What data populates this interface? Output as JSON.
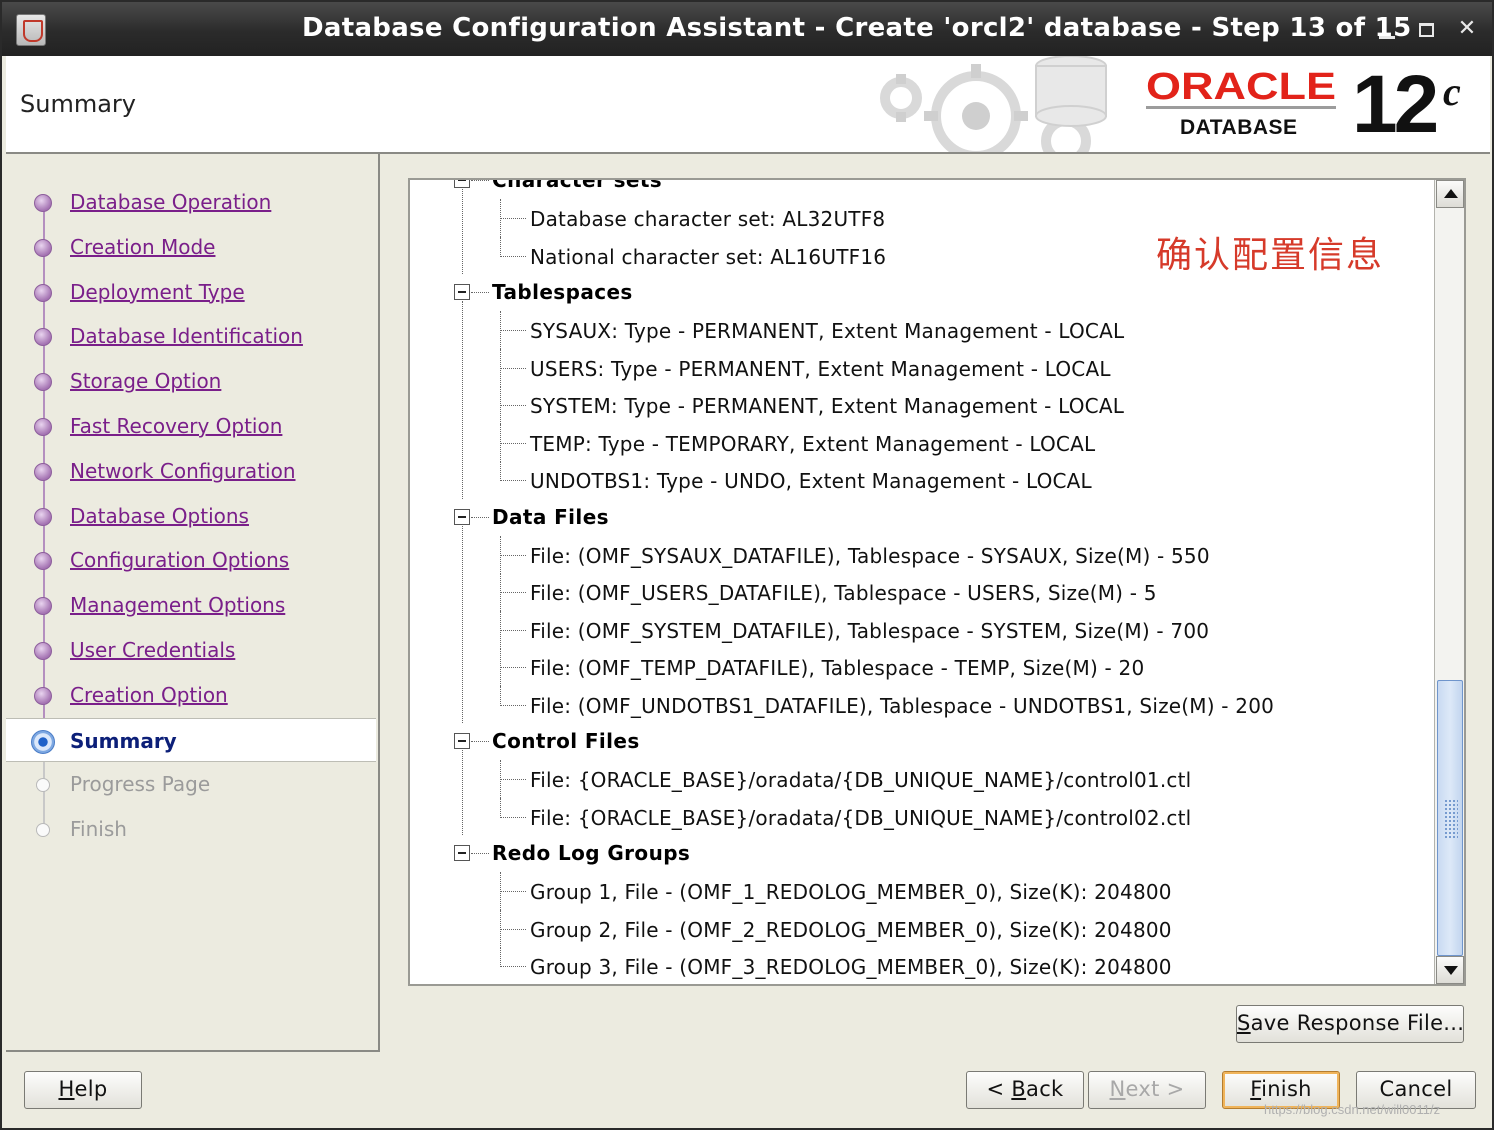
{
  "window": {
    "title": "Database Configuration Assistant - Create 'orcl2' database - Step 13 of 15"
  },
  "header": {
    "page_title": "Summary",
    "logo_brand": "ORACLE",
    "logo_product": "DATABASE",
    "logo_version": "12",
    "logo_version_suffix": "c"
  },
  "nav": {
    "items": [
      {
        "label": "Database Operation",
        "state": "done"
      },
      {
        "label": "Creation Mode",
        "state": "done"
      },
      {
        "label": "Deployment Type",
        "state": "done"
      },
      {
        "label": "Database Identification",
        "state": "done"
      },
      {
        "label": "Storage Option",
        "state": "done"
      },
      {
        "label": "Fast Recovery Option",
        "state": "done"
      },
      {
        "label": "Network Configuration",
        "state": "done"
      },
      {
        "label": "Database Options",
        "state": "done"
      },
      {
        "label": "Configuration Options",
        "state": "done"
      },
      {
        "label": "Management Options",
        "state": "done"
      },
      {
        "label": "User Credentials",
        "state": "done"
      },
      {
        "label": "Creation Option",
        "state": "done"
      },
      {
        "label": "Summary",
        "state": "current"
      },
      {
        "label": "Progress Page",
        "state": "pending"
      },
      {
        "label": "Finish",
        "state": "pending"
      }
    ]
  },
  "summary": {
    "annotation": "确认配置信息",
    "sections": [
      {
        "title": "Character sets",
        "items": [
          "Database character set: AL32UTF8",
          "National character set: AL16UTF16"
        ]
      },
      {
        "title": "Tablespaces",
        "items": [
          "SYSAUX: Type - PERMANENT, Extent Management - LOCAL",
          "USERS: Type - PERMANENT, Extent Management - LOCAL",
          "SYSTEM: Type - PERMANENT, Extent Management - LOCAL",
          "TEMP: Type - TEMPORARY, Extent Management - LOCAL",
          "UNDOTBS1: Type - UNDO, Extent Management - LOCAL"
        ]
      },
      {
        "title": "Data Files",
        "items": [
          "File: (OMF_SYSAUX_DATAFILE), Tablespace - SYSAUX, Size(M) - 550",
          "File: (OMF_USERS_DATAFILE), Tablespace - USERS, Size(M) - 5",
          "File: (OMF_SYSTEM_DATAFILE), Tablespace - SYSTEM, Size(M) - 700",
          "File: (OMF_TEMP_DATAFILE), Tablespace - TEMP, Size(M) - 20",
          "File: (OMF_UNDOTBS1_DATAFILE), Tablespace - UNDOTBS1, Size(M) - 200"
        ]
      },
      {
        "title": "Control Files",
        "items": [
          "File: {ORACLE_BASE}/oradata/{DB_UNIQUE_NAME}/control01.ctl",
          "File: {ORACLE_BASE}/oradata/{DB_UNIQUE_NAME}/control02.ctl"
        ]
      },
      {
        "title": "Redo Log Groups",
        "items": [
          "Group 1, File - (OMF_1_REDOLOG_MEMBER_0), Size(K): 204800",
          "Group 2, File - (OMF_2_REDOLOG_MEMBER_0), Size(K): 204800",
          "Group 3, File - (OMF_3_REDOLOG_MEMBER_0), Size(K): 204800"
        ]
      }
    ]
  },
  "buttons": {
    "save_response_mnemonic": "S",
    "save_response_rest": "ave Response File...",
    "help_mnemonic": "H",
    "help_rest": "elp",
    "back_prefix": "< ",
    "back_mnemonic": "B",
    "back_rest": "ack",
    "next_mnemonic": "N",
    "next_rest": "ext >",
    "finish_mnemonic": "F",
    "finish_rest": "inish",
    "cancel_label": "Cancel"
  },
  "watermark": "https://blog.csdn.net/will0011/z"
}
